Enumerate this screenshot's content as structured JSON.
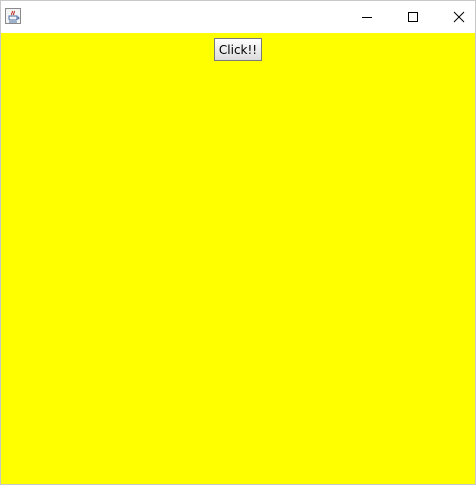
{
  "window": {
    "title": "",
    "app_icon": "java-icon",
    "controls": {
      "minimize_icon": "minimize-icon",
      "maximize_icon": "maximize-icon",
      "close_icon": "close-icon"
    },
    "client_background": "#ffff00"
  },
  "main": {
    "button_label": "Click!!"
  }
}
